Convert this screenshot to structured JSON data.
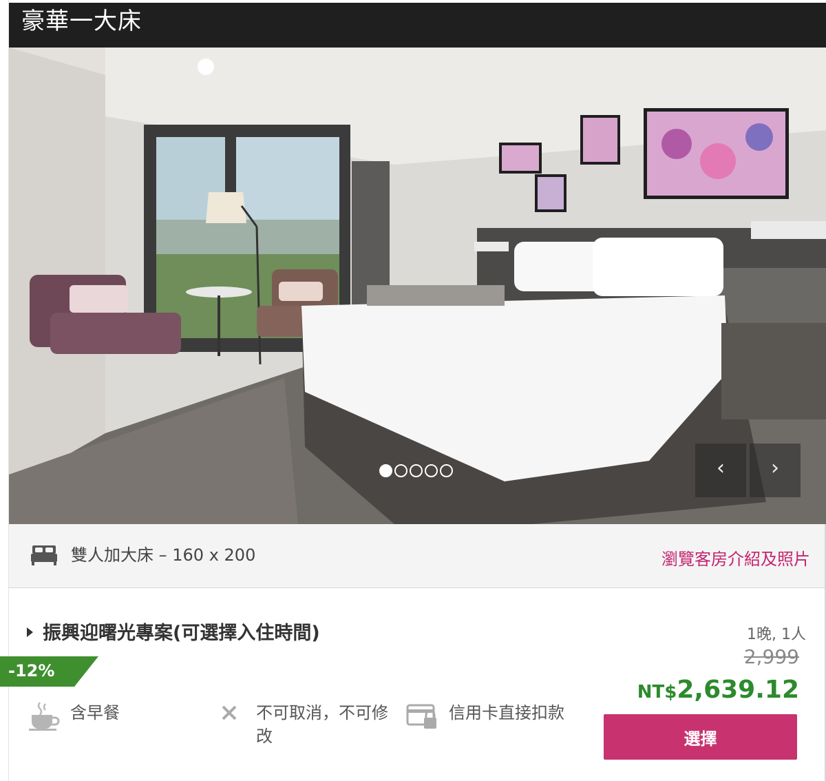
{
  "room": {
    "title": "豪華一大床"
  },
  "gallery": {
    "slide_count": 5,
    "active_index": 0,
    "prev_glyph": "‹",
    "next_glyph": "›"
  },
  "bed": {
    "icon": "bed-icon",
    "label": "雙人加大床 – 160 x 200",
    "browse_link": "瀏覽客房介紹及照片"
  },
  "plan": {
    "title": "振興迎曙光專案(可選擇入住時間)",
    "discount_badge": "-12%",
    "stay_info": "1晚, 1人",
    "original_price": "2,999",
    "currency": "NT$",
    "price": "2,639.12",
    "features": [
      {
        "icon": "coffee-cup-icon",
        "label": "含早餐"
      },
      {
        "icon": "x-mark-icon",
        "label": "不可取消，不可修改"
      },
      {
        "icon": "credit-card-lock-icon",
        "label": "信用卡直接扣款"
      }
    ],
    "select_button": "選擇"
  },
  "colors": {
    "title_bar": "#1f1f1f",
    "accent_pink": "#c8336f",
    "link_pink": "#c4246f",
    "price_green": "#2d8a2d",
    "badge_green": "#3f8f2f"
  }
}
